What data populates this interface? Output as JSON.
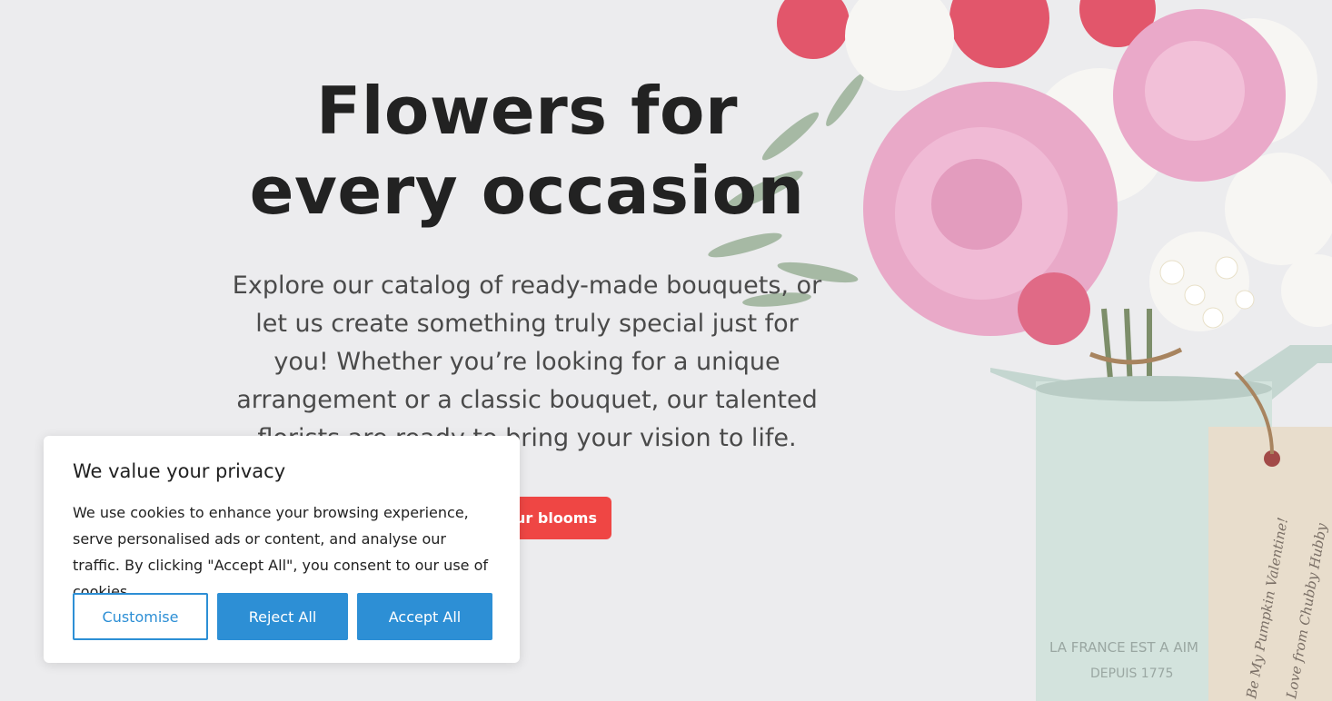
{
  "hero": {
    "title": "Flowers for every occasion",
    "text": "Explore our catalog of ready-made bouquets, or let us create something truly special just for you! Whether you’re looking for a unique arrangement or a classic bouquet, our talented florists are ready to bring your vision to life.",
    "cta_label": "our blooms",
    "image": {
      "jug_text_line1": "LA FRANCE EST A AIM",
      "jug_text_line2": "DEPUIS 1775",
      "tag_text_line1": "Be My Pumpkin Valentine!",
      "tag_text_line2": "Love from Chubby Hubby"
    }
  },
  "cookie": {
    "title": "We value your privacy",
    "text": "We use cookies to enhance your browsing experience, serve personalised ads or content, and analyse our traffic. By clicking \"Accept All\", you consent to our use of cookies.",
    "customise_label": "Customise",
    "reject_label": "Reject All",
    "accept_label": "Accept All"
  },
  "colors": {
    "background": "#ececee",
    "cta": "#ef4644",
    "cookie_accent": "#2d8fd5"
  }
}
